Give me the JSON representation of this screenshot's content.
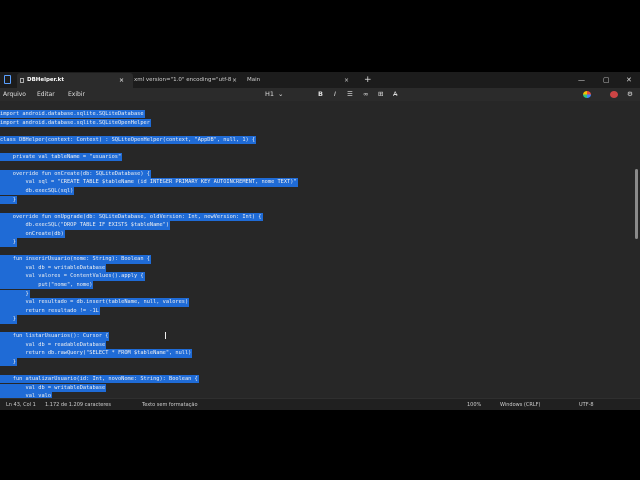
{
  "tabs": [
    {
      "label": "DBHelper.kt"
    },
    {
      "label": "xml version=\"1.0\" encoding=\"utf-8"
    },
    {
      "label": "Main"
    }
  ],
  "menu": [
    "Arquivo",
    "Editar",
    "Exibir"
  ],
  "toolbar": {
    "heading": "H1",
    "heading_chevron": "⌄",
    "bold": "B",
    "italic": "I",
    "list": "☰",
    "link": "∞",
    "table": "⊞",
    "clear": "A̶"
  },
  "window_controls": {
    "minimize": "—",
    "maximize": "▢",
    "close": "✕",
    "new_tab": "+",
    "tab_close": "×"
  },
  "code_lines": [
    "import android.database.sqlite.SQLiteDatabase",
    "import android.database.sqlite.SQLiteOpenHelper",
    "",
    "class DBHelper(context: Context) : SQLiteOpenHelper(context, \"AppDB\", null, 1) {",
    "",
    "    private val tableName = \"usuarios\"",
    "",
    "    override fun onCreate(db: SQLiteDatabase) {",
    "        val sql = \"CREATE TABLE $tableName (id INTEGER PRIMARY KEY AUTOINCREMENT, nome TEXT)\"",
    "        db.execSQL(sql)",
    "    }",
    "",
    "    override fun onUpgrade(db: SQLiteDatabase, oldVersion: Int, newVersion: Int) {",
    "        db.execSQL(\"DROP TABLE IF EXISTS $tableName\")",
    "        onCreate(db)",
    "    }",
    "",
    "    fun inserirUsuario(nome: String): Boolean {",
    "        val db = writableDatabase",
    "        val valores = ContentValues().apply {",
    "            put(\"nome\", nome)",
    "        }",
    "        val resultado = db.insert(tableName, null, valores)",
    "        return resultado != -1L",
    "    }",
    "",
    "    fun listarUsuarios(): Cursor {",
    "        val db = readableDatabase",
    "        return db.rawQuery(\"SELECT * FROM $tableName\", null)",
    "    }",
    "",
    "    fun atualizarUsuario(id: Int, novoNome: String): Boolean {",
    "        val db = writableDatabase",
    "        val valo"
  ],
  "status": {
    "position": "Ln 43, Col 1",
    "chars": "1.172 de 1.209 caracteres",
    "format": "Texto sem formatação",
    "zoom": "100%",
    "line_ending": "Windows (CRLF)",
    "encoding": "UTF-8"
  }
}
